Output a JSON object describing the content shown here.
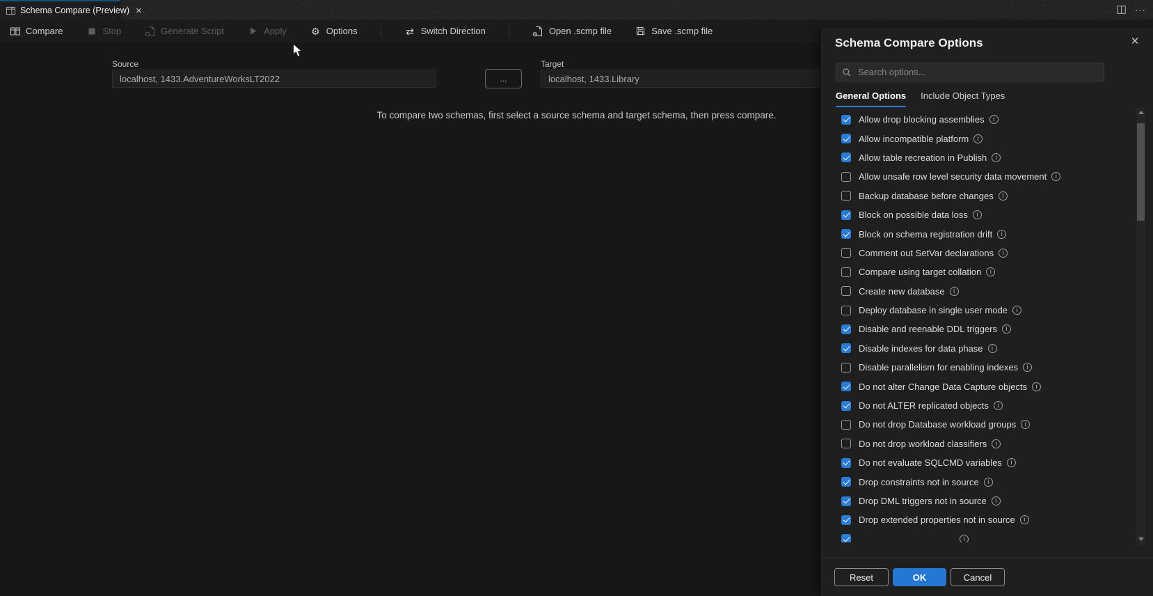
{
  "tab_bar": {
    "active_tab_label": "Schema Compare (Preview)",
    "close_glyph": "×",
    "more_actions_glyph": "···"
  },
  "toolbar": {
    "items": [
      {
        "label": "Compare",
        "icon": "compare",
        "enabled": true,
        "divider_after": false
      },
      {
        "label": "Stop",
        "icon": "stop",
        "enabled": false,
        "divider_after": false
      },
      {
        "label": "Generate Script",
        "icon": "script",
        "enabled": false,
        "divider_after": false
      },
      {
        "label": "Apply",
        "icon": "play",
        "enabled": false,
        "divider_after": false
      },
      {
        "label": "Options",
        "icon": "gear",
        "enabled": true,
        "divider_after": true
      },
      {
        "label": "Switch Direction",
        "icon": "swap",
        "enabled": true,
        "divider_after": true
      },
      {
        "label": "Open .scmp file",
        "icon": "file",
        "enabled": true,
        "divider_after": false
      },
      {
        "label": "Save .scmp file",
        "icon": "save",
        "enabled": true,
        "divider_after": false
      }
    ]
  },
  "compare_form": {
    "source_label": "Source",
    "source_value": "localhost, 1433.AdventureWorksLT2022",
    "browse_label": "...",
    "target_label": "Target",
    "target_value": "localhost, 1433.Library"
  },
  "editor_message": "To compare two schemas, first select a source schema and target schema, then press compare.",
  "options_panel": {
    "title": "Schema Compare Options",
    "close_glyph": "×",
    "search_placeholder": "Search options...",
    "tabs": [
      {
        "label": "General Options",
        "active": true
      },
      {
        "label": "Include Object Types",
        "active": false
      }
    ],
    "options": [
      {
        "label": "Allow drop blocking assemblies",
        "checked": true,
        "partial": false
      },
      {
        "label": "Allow incompatible platform",
        "checked": true,
        "partial": false
      },
      {
        "label": "Allow table recreation in Publish",
        "checked": true,
        "partial": false
      },
      {
        "label": "Allow unsafe row level security data movement",
        "checked": false,
        "partial": false
      },
      {
        "label": "Backup database before changes",
        "checked": false,
        "partial": false
      },
      {
        "label": "Block on possible data loss",
        "checked": true,
        "partial": false
      },
      {
        "label": "Block on schema registration drift",
        "checked": true,
        "partial": false
      },
      {
        "label": "Comment out SetVar declarations",
        "checked": false,
        "partial": false
      },
      {
        "label": "Compare using target collation",
        "checked": false,
        "partial": false
      },
      {
        "label": "Create new database",
        "checked": false,
        "partial": false
      },
      {
        "label": "Deploy database in single user mode",
        "checked": false,
        "partial": false
      },
      {
        "label": "Disable and reenable DDL triggers",
        "checked": true,
        "partial": false
      },
      {
        "label": "Disable indexes for data phase",
        "checked": true,
        "partial": false
      },
      {
        "label": "Disable parallelism for enabling indexes",
        "checked": false,
        "partial": false
      },
      {
        "label": "Do not alter Change Data Capture objects",
        "checked": true,
        "partial": false
      },
      {
        "label": "Do not ALTER replicated objects",
        "checked": true,
        "partial": false
      },
      {
        "label": "Do not drop Database workload groups",
        "checked": false,
        "partial": false
      },
      {
        "label": "Do not drop workload classifiers",
        "checked": false,
        "partial": false
      },
      {
        "label": "Do not evaluate SQLCMD variables",
        "checked": true,
        "partial": false
      },
      {
        "label": "Drop constraints not in source",
        "checked": true,
        "partial": false
      },
      {
        "label": "Drop DML triggers not in source",
        "checked": true,
        "partial": false
      },
      {
        "label": "Drop extended properties not in source",
        "checked": true,
        "partial": false
      },
      {
        "label": "",
        "checked": true,
        "partial": true
      }
    ],
    "footer_buttons": {
      "reset": "Reset",
      "ok": "OK",
      "cancel": "Cancel"
    }
  },
  "colors": {
    "accent_blue": "#2b7cd4",
    "ok_button_blue": "#2677cf",
    "tab_accent": "#16527f",
    "panel_bg": "#1f1f1f",
    "editor_bg": "#171717"
  }
}
